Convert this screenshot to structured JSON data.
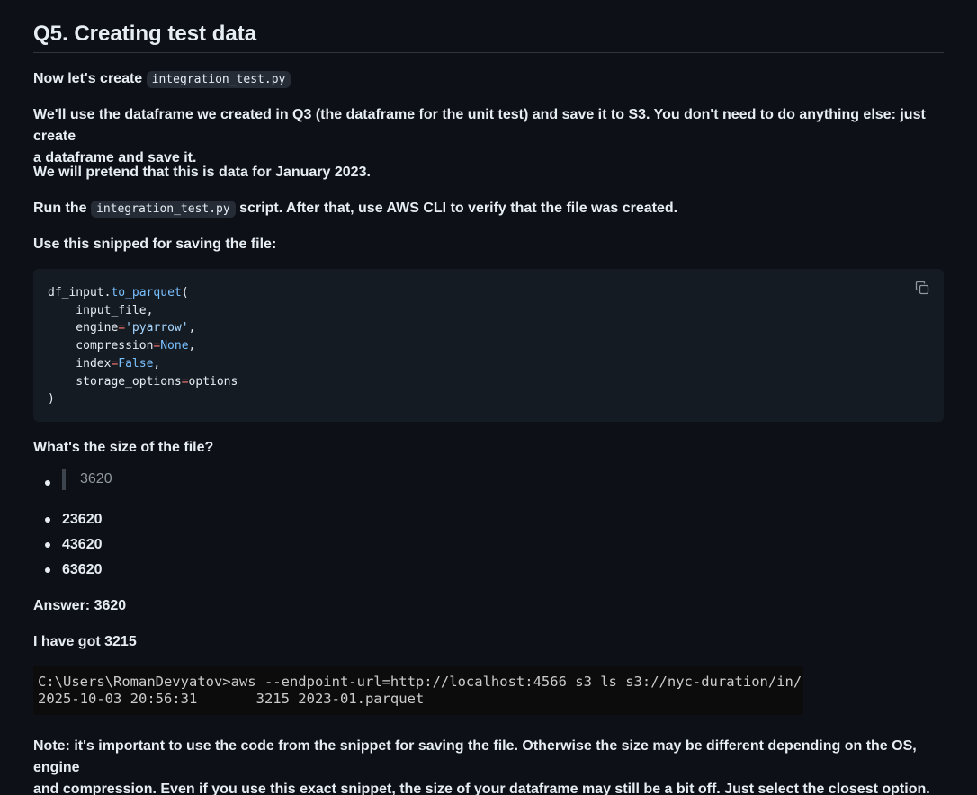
{
  "heading": "Q5. Creating test data",
  "intro": {
    "prefix": "Now let's create ",
    "code": "integration_test.py"
  },
  "paragraph1_line1": "We'll use the dataframe we created in Q3 (the dataframe for the unit test) and save it to S3. You don't need to do anything else: just create",
  "paragraph1_line2": "a dataframe and save it.",
  "paragraph2": "We will pretend that this is data for January 2023.",
  "run": {
    "prefix": "Run the ",
    "code": "integration_test.py",
    "suffix": " script. After that, use AWS CLI to verify that the file was created."
  },
  "snippet_intro": "Use this snipped for saving the file:",
  "code_block": {
    "l1_obj": "df_input.",
    "l1_fn": "to_parquet",
    "l1_paren": "(",
    "l2": "    input_file,",
    "l3_key": "    engine",
    "l3_eq": "=",
    "l3_val": "'pyarrow'",
    "l3_end": ",",
    "l4_key": "    compression",
    "l4_eq": "=",
    "l4_val": "None",
    "l4_end": ",",
    "l5_key": "    index",
    "l5_eq": "=",
    "l5_val": "False",
    "l5_end": ",",
    "l6_key": "    storage_options",
    "l6_eq": "=",
    "l6_val": "options",
    "l7": ")",
    "copy_icon": "copy-icon"
  },
  "question": "What's the size of the file?",
  "options": {
    "selected": "3620",
    "o2": "23620",
    "o3": "43620",
    "o4": "63620"
  },
  "answer": "Answer: 3620",
  "got": "I have got 3215",
  "terminal": {
    "line1": "C:\\Users\\RomanDevyatov>aws --endpoint-url=http://localhost:4566 s3 ls s3://nyc-duration/in/",
    "line2": "2025-10-03 20:56:31       3215 2023-01.parquet"
  },
  "note_line1": "Note: it's important to use the code from the snippet for saving the file. Otherwise the size may be different depending on the OS, engine",
  "note_line2": "and compression. Even if you use this exact snippet, the size of your dataframe may still be a bit off. Just select the closest option.",
  "colors": {
    "background": "#0d1117",
    "text": "#e6edf3",
    "code_block_bg": "#151b23",
    "inline_code_bg": "#262c36",
    "terminal_bg": "#0c0c0c",
    "keyword": "#79c0ff",
    "string": "#a5d6ff",
    "function": "#d2a8ff",
    "operator": "#ff7b72"
  }
}
